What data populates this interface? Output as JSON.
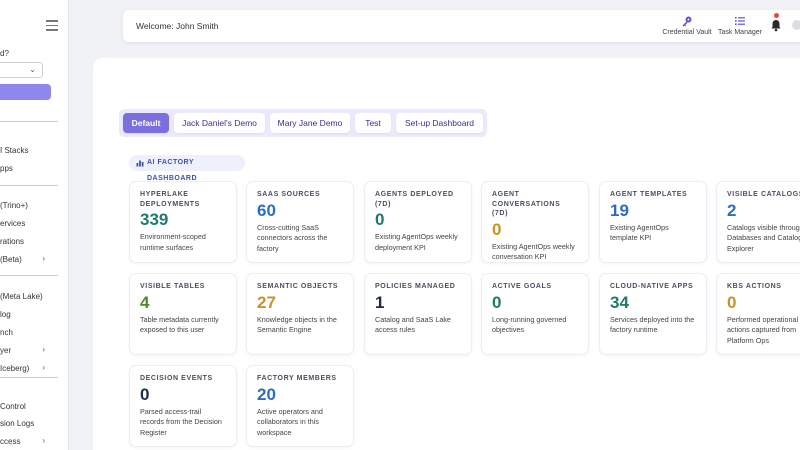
{
  "sidebar": {
    "question": "d?",
    "select_value": "",
    "items_group1": [
      "I Stacks",
      "pps"
    ],
    "items_group2": [
      "(Trino+)",
      "ervices",
      "rations",
      "(Beta)"
    ],
    "items_group3": [
      "(Meta Lake)",
      "log",
      "nch",
      "yer",
      "Iceberg)"
    ],
    "items_group4": [
      " Control",
      "sion Logs",
      "ccess"
    ]
  },
  "header": {
    "welcome": "Welcome: John Smith",
    "credential_vault": "Credential Vault",
    "task_manager": "Task Manager"
  },
  "tabs": [
    {
      "label": "Default",
      "active": true
    },
    {
      "label": "Jack Daniel's Demo",
      "active": false
    },
    {
      "label": "Mary Jane Demo",
      "active": false
    },
    {
      "label": "Test",
      "active": false
    },
    {
      "label": "Set-up Dashboard",
      "active": false
    }
  ],
  "section_title": "AI FACTORY DASHBOARD",
  "colors": {
    "accent": "#7b6fe0",
    "blue": "#2d6cc0",
    "teal": "#1f7a6e",
    "gold": "#c7922a",
    "green": "#4a8a2e",
    "navy": "#1d2b4d"
  },
  "cards": [
    {
      "label": "HYPERLAKE DEPLOYMENTS",
      "value": "339",
      "color": "#1f7a6e",
      "desc": "Environment-scoped runtime surfaces"
    },
    {
      "label": "SAAS SOURCES",
      "value": "60",
      "color": "#2d6cc0",
      "desc": "Cross-cutting SaaS connectors across the factory"
    },
    {
      "label": "AGENTS DEPLOYED (7D)",
      "value": "0",
      "color": "#1f7a6e",
      "desc": "Existing AgentOps weekly deployment KPI"
    },
    {
      "label": "AGENT CONVERSATIONS (7D)",
      "value": "0",
      "color": "#c7922a",
      "desc": "Existing AgentOps weekly conversation KPI"
    },
    {
      "label": "AGENT TEMPLATES",
      "value": "19",
      "color": "#2d6cc0",
      "desc": "Existing AgentOps template KPI"
    },
    {
      "label": "VISIBLE CATALOGS",
      "value": "2",
      "color": "#2d6cc0",
      "desc": "Catalogs visible through Databases and Catalog Explorer"
    },
    {
      "label": "VISIBLE TABLES",
      "value": "4",
      "color": "#4a8a2e",
      "desc": "Table metadata currently exposed to this user"
    },
    {
      "label": "SEMANTIC OBJECTS",
      "value": "27",
      "color": "#c7922a",
      "desc": "Knowledge objects in the Semantic Engine"
    },
    {
      "label": "POLICIES MANAGED",
      "value": "1",
      "color": "#1d2b4d",
      "desc": "Catalog and SaaS Lake access rules"
    },
    {
      "label": "ACTIVE GOALS",
      "value": "0",
      "color": "#1f7a6e",
      "desc": "Long-running governed objectives"
    },
    {
      "label": "CLOUD-NATIVE APPS",
      "value": "34",
      "color": "#1f7a6e",
      "desc": "Services deployed into the factory runtime"
    },
    {
      "label": "KBS ACTIONS",
      "value": "0",
      "color": "#c7922a",
      "desc": "Performed operational actions captured from Platform Ops"
    },
    {
      "label": "DECISION EVENTS",
      "value": "0",
      "color": "#1d2b4d",
      "desc": "Parsed access-trail records from the Decision Register"
    },
    {
      "label": "FACTORY MEMBERS",
      "value": "20",
      "color": "#2d6cc0",
      "desc": "Active operators and collaborators in this workspace"
    }
  ]
}
